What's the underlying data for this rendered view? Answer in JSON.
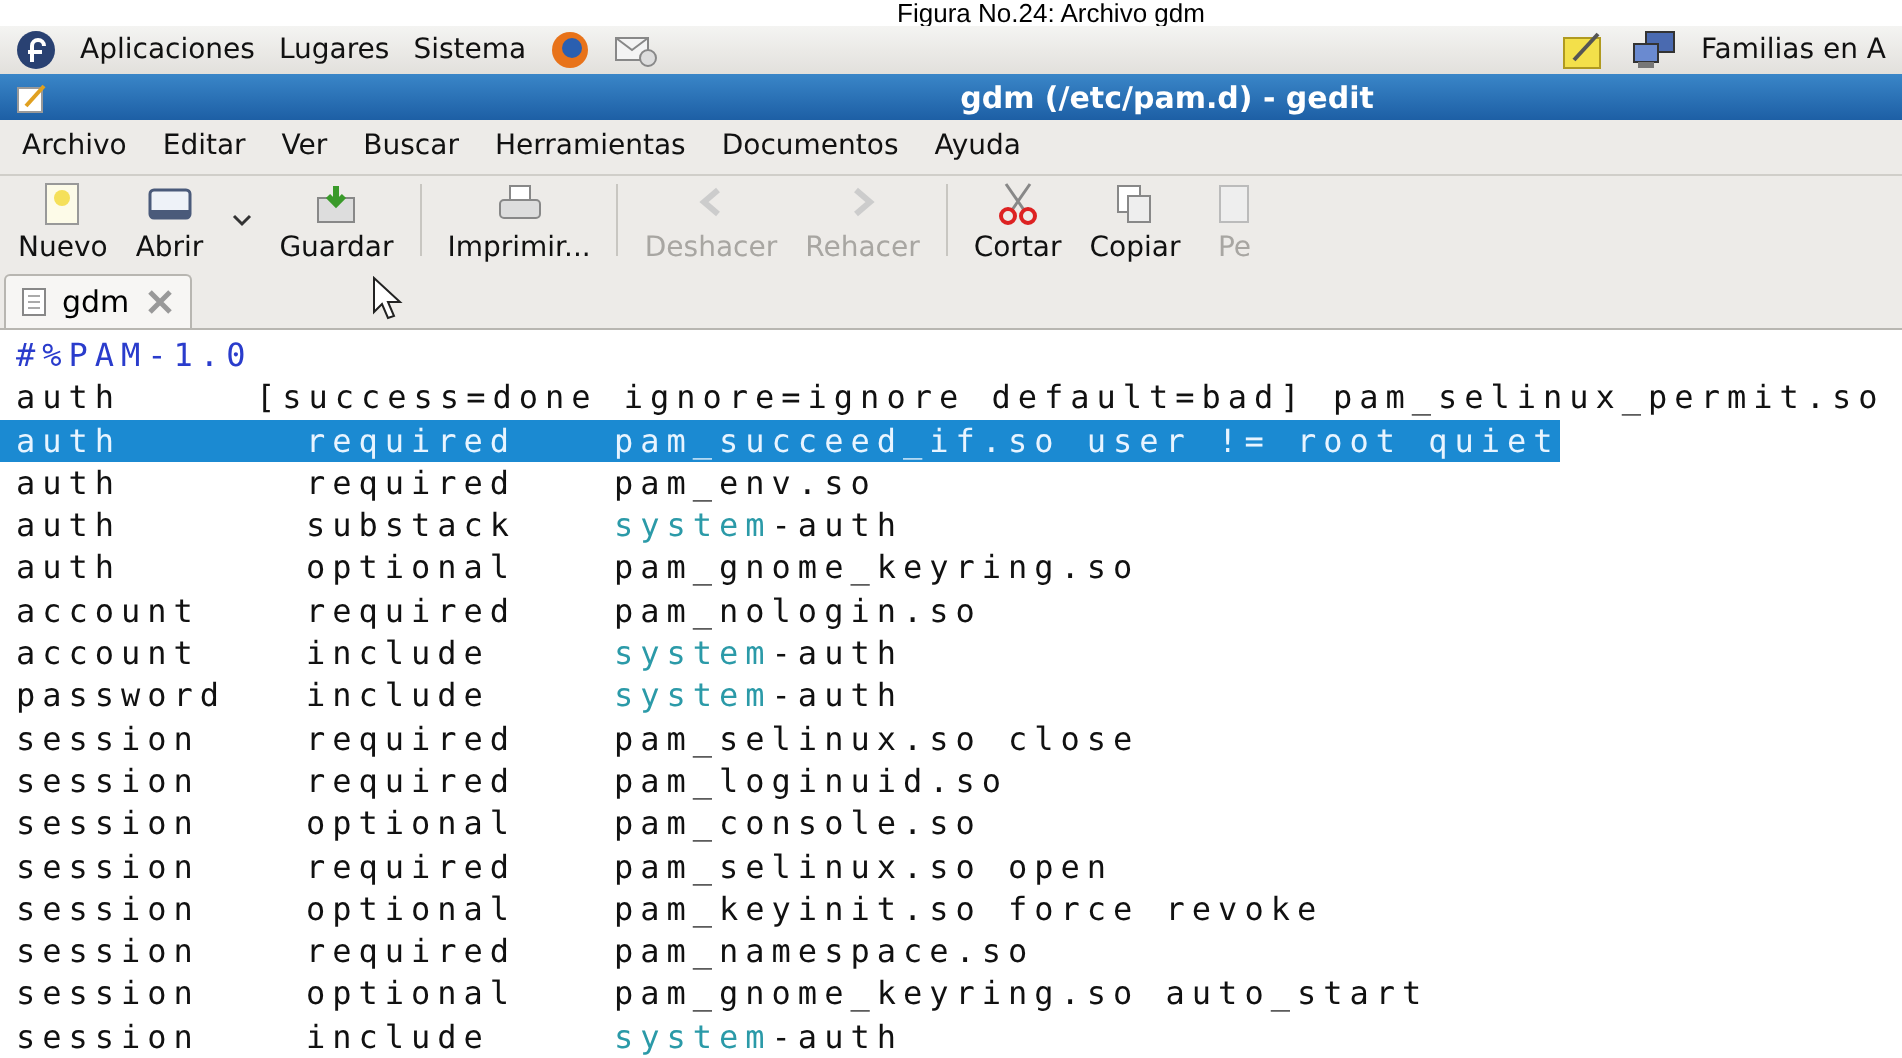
{
  "caption": "Figura No.24: Archivo gdm",
  "panel": {
    "menus": [
      "Aplicaciones",
      "Lugares",
      "Sistema"
    ],
    "right_label": "Familias en A"
  },
  "window": {
    "title": "gdm (/etc/pam.d) - gedit"
  },
  "menubar": [
    "Archivo",
    "Editar",
    "Ver",
    "Buscar",
    "Herramientas",
    "Documentos",
    "Ayuda"
  ],
  "toolbar": [
    {
      "kind": "button",
      "label": "Nuevo",
      "disabled": false
    },
    {
      "kind": "button",
      "label": "Abrir",
      "disabled": false
    },
    {
      "kind": "dropdown"
    },
    {
      "kind": "button",
      "label": "Guardar",
      "disabled": false
    },
    {
      "kind": "separator"
    },
    {
      "kind": "button",
      "label": "Imprimir...",
      "disabled": false
    },
    {
      "kind": "separator"
    },
    {
      "kind": "button",
      "label": "Deshacer",
      "disabled": true
    },
    {
      "kind": "button",
      "label": "Rehacer",
      "disabled": true
    },
    {
      "kind": "separator"
    },
    {
      "kind": "button",
      "label": "Cortar",
      "disabled": false
    },
    {
      "kind": "button",
      "label": "Copiar",
      "disabled": false
    },
    {
      "kind": "button",
      "label": "Pe",
      "disabled": true
    }
  ],
  "tabs": [
    {
      "label": "gdm",
      "selected": true
    }
  ],
  "lines": [
    {
      "kind": "comment",
      "text": "#%PAM-1.0",
      "selected": false
    },
    {
      "kind": "inline",
      "type": "auth",
      "control": "[success=done ignore=ignore default=bad]",
      "module": [
        {
          "kind": "plain",
          "text": "pam_selinux_permit.so"
        }
      ],
      "selected": false
    },
    {
      "kind": "rule",
      "type": "auth",
      "control": "required",
      "module": [
        {
          "kind": "plain",
          "text": "pam_succeed_if.so user != root quiet"
        }
      ],
      "selected": true
    },
    {
      "kind": "rule",
      "type": "auth",
      "control": "required",
      "module": [
        {
          "kind": "plain",
          "text": "pam_env.so"
        }
      ],
      "selected": false
    },
    {
      "kind": "rule",
      "type": "auth",
      "control": "substack",
      "module": [
        {
          "kind": "keyword",
          "text": "system"
        },
        {
          "kind": "plain",
          "text": "-auth"
        }
      ],
      "selected": false
    },
    {
      "kind": "rule",
      "type": "auth",
      "control": "optional",
      "module": [
        {
          "kind": "plain",
          "text": "pam_gnome_keyring.so"
        }
      ],
      "selected": false
    },
    {
      "kind": "rule",
      "type": "account",
      "control": "required",
      "module": [
        {
          "kind": "plain",
          "text": "pam_nologin.so"
        }
      ],
      "selected": false
    },
    {
      "kind": "rule",
      "type": "account",
      "control": "include",
      "module": [
        {
          "kind": "keyword",
          "text": "system"
        },
        {
          "kind": "plain",
          "text": "-auth"
        }
      ],
      "selected": false
    },
    {
      "kind": "rule",
      "type": "password",
      "control": "include",
      "module": [
        {
          "kind": "keyword",
          "text": "system"
        },
        {
          "kind": "plain",
          "text": "-auth"
        }
      ],
      "selected": false
    },
    {
      "kind": "rule",
      "type": "session",
      "control": "required",
      "module": [
        {
          "kind": "plain",
          "text": "pam_selinux.so close"
        }
      ],
      "selected": false
    },
    {
      "kind": "rule",
      "type": "session",
      "control": "required",
      "module": [
        {
          "kind": "plain",
          "text": "pam_loginuid.so"
        }
      ],
      "selected": false
    },
    {
      "kind": "rule",
      "type": "session",
      "control": "optional",
      "module": [
        {
          "kind": "plain",
          "text": "pam_console.so"
        }
      ],
      "selected": false
    },
    {
      "kind": "rule",
      "type": "session",
      "control": "required",
      "module": [
        {
          "kind": "plain",
          "text": "pam_selinux.so open"
        }
      ],
      "selected": false
    },
    {
      "kind": "rule",
      "type": "session",
      "control": "optional",
      "module": [
        {
          "kind": "plain",
          "text": "pam_keyinit.so force revoke"
        }
      ],
      "selected": false
    },
    {
      "kind": "rule",
      "type": "session",
      "control": "required",
      "module": [
        {
          "kind": "plain",
          "text": "pam_namespace.so"
        }
      ],
      "selected": false
    },
    {
      "kind": "rule",
      "type": "session",
      "control": "optional",
      "module": [
        {
          "kind": "plain",
          "text": "pam_gnome_keyring.so auto_start"
        }
      ],
      "selected": false
    },
    {
      "kind": "rule",
      "type": "session",
      "control": "include",
      "module": [
        {
          "kind": "keyword",
          "text": "system"
        },
        {
          "kind": "plain",
          "text": "-auth"
        }
      ],
      "selected": false
    }
  ]
}
